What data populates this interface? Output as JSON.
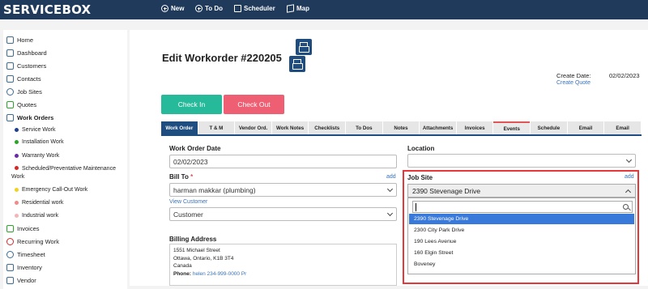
{
  "app": {
    "logo": "SERVICEBOX",
    "nav": [
      {
        "label": "New",
        "icon": "plus-circle-icon"
      },
      {
        "label": "To Do",
        "icon": "plus-circle-icon"
      },
      {
        "label": "Scheduler",
        "icon": "calendar-icon"
      },
      {
        "label": "Map",
        "icon": "map-icon"
      }
    ]
  },
  "sidebar": {
    "items": [
      {
        "label": "Home",
        "icon": "home-icon"
      },
      {
        "label": "Dashboard",
        "icon": "dashboard-icon"
      },
      {
        "label": "Customers",
        "icon": "customers-icon"
      },
      {
        "label": "Contacts",
        "icon": "contacts-icon"
      },
      {
        "label": "Job Sites",
        "icon": "location-pin-icon"
      },
      {
        "label": "Quotes",
        "icon": "dollar-icon"
      },
      {
        "label": "Work Orders",
        "icon": "clipboard-icon"
      }
    ],
    "work_order_types": [
      {
        "label": "Service Work",
        "color": "#1f3f8f"
      },
      {
        "label": "Installation Work",
        "color": "#2aa52a"
      },
      {
        "label": "Warranty Work",
        "color": "#6a2aa8"
      },
      {
        "label": "Scheduled/Preventative Maintenance Work",
        "color": "#d62828"
      },
      {
        "label": "Emergency Call-Out Work",
        "color": "#f2d21b"
      },
      {
        "label": "Residential work",
        "color": "#f08a8a"
      },
      {
        "label": "Industrial work",
        "color": "#f5b5b5"
      }
    ],
    "items_after": [
      {
        "label": "Invoices",
        "icon": "invoice-icon"
      },
      {
        "label": "Recurring Work",
        "icon": "recurring-icon"
      },
      {
        "label": "Timesheet",
        "icon": "clock-icon"
      },
      {
        "label": "Inventory",
        "icon": "inventory-icon"
      },
      {
        "label": "Vendor",
        "icon": "vendor-icon"
      }
    ]
  },
  "page": {
    "title": "Edit Workorder #220205",
    "create_date_label": "Create Date:",
    "create_date": "02/02/2023",
    "create_quote": "Create Quote",
    "check_in": "Check In",
    "check_out": "Check Out"
  },
  "tabs": [
    "Work Order",
    "T & M",
    "Vendor Ord.",
    "Work Notes",
    "Checklists",
    "To Dos",
    "Notes",
    "Attachments",
    "Invoices",
    "Events",
    "Schedule",
    "Email",
    "Email"
  ],
  "form": {
    "work_order_date_label": "Work Order Date",
    "work_order_date": "02/02/2023",
    "bill_to_label": "Bill To",
    "bill_to_required": "*",
    "add_label": "add",
    "bill_to_value": "harman makkar (plumbing)",
    "view_customer": "View Customer",
    "customer_type": "Customer",
    "billing_address_label": "Billing Address",
    "billing_address_line1": "1551 Michael Street",
    "billing_address_line2": "Ottawa, Ontario, K1B 3T4",
    "billing_address_line3": "Canada",
    "phone_label": "Phone:",
    "phone_value": "helen 234-999-0000 Pr",
    "location_label": "Location",
    "location_value": "",
    "job_site_label": "Job Site",
    "job_site_add": "add",
    "job_site_value": "2390 Stevenage Drive",
    "job_site_search": "",
    "job_site_options": [
      "2390 Stevenage Drive",
      "2300 City Park Drive",
      "190 Lees Avenue",
      "160 Elgin Street",
      "Boveney"
    ]
  }
}
